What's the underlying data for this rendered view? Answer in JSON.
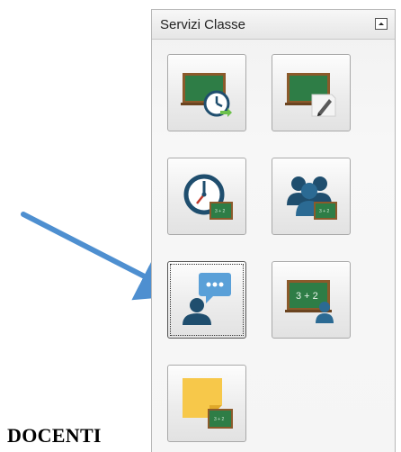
{
  "panel": {
    "title": "Servizi Classe",
    "tiles": [
      {
        "id": "board-clock",
        "icon": "classroom-board-clock-icon"
      },
      {
        "id": "board-pencil",
        "icon": "classroom-board-pencil-icon"
      },
      {
        "id": "clock-board",
        "icon": "clock-with-board-icon"
      },
      {
        "id": "group-board",
        "icon": "students-group-board-icon"
      },
      {
        "id": "teacher-chat",
        "icon": "teacher-chat-bubble-icon",
        "selected": true
      },
      {
        "id": "board-math-teacher",
        "icon": "math-board-teacher-icon"
      },
      {
        "id": "sticky-note-board",
        "icon": "sticky-note-board-icon"
      }
    ]
  },
  "caption": {
    "text": "DOCENTI"
  },
  "board_math_text": "3 + 2",
  "colors": {
    "board": "#2e7d46",
    "frame": "#8b5a2b",
    "person": "#1f4e6e",
    "accent": "#5aa0d8",
    "arrow": "#4e8fd0"
  }
}
